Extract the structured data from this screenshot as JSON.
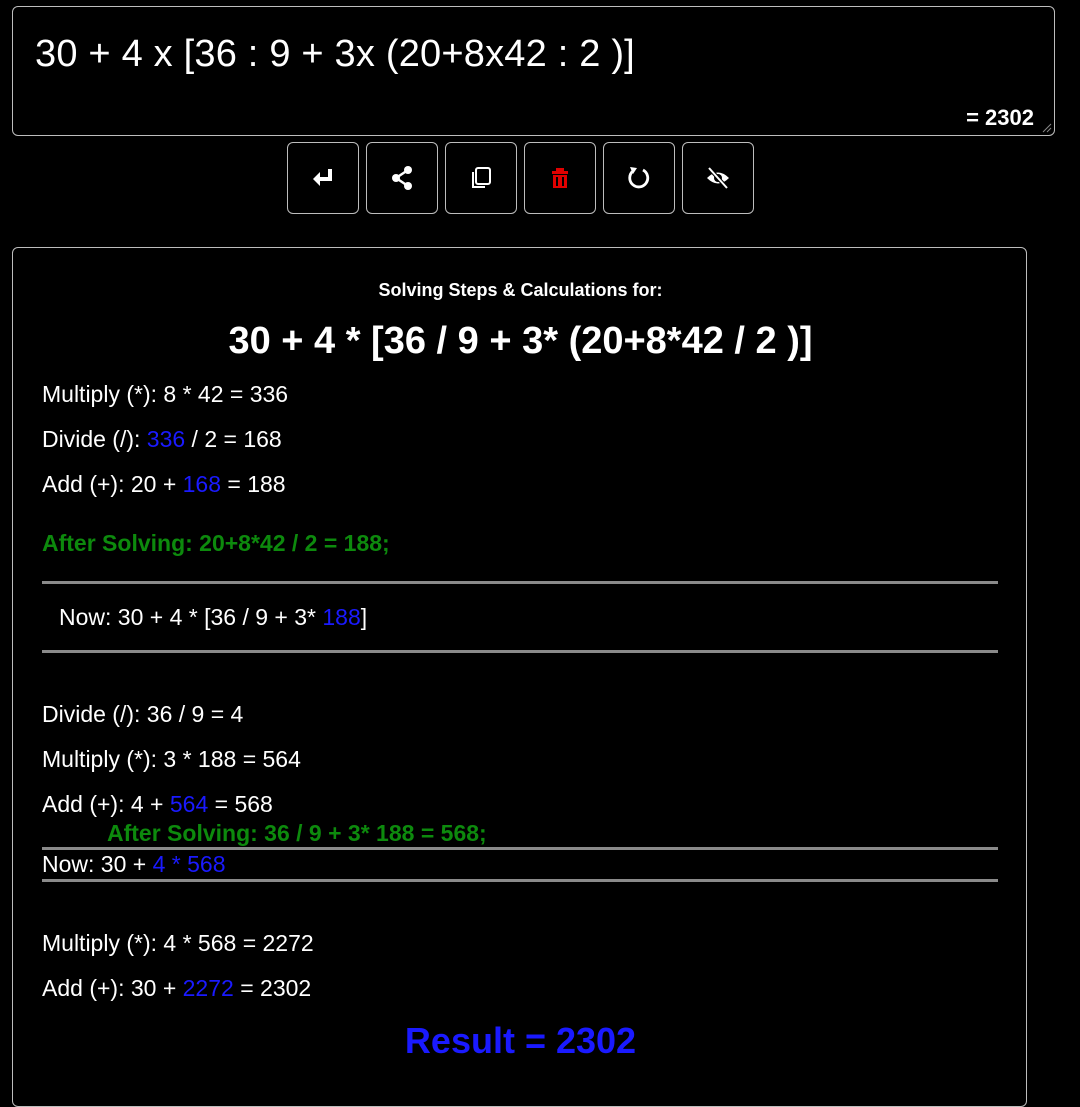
{
  "input": {
    "expression": "30 + 4 x [36 : 9 + 3x (20+8x42 : 2 )]",
    "result": "= 2302"
  },
  "toolbar": {
    "buttons": [
      {
        "name": "enter-button",
        "icon": "enter-icon"
      },
      {
        "name": "share-button",
        "icon": "share-icon"
      },
      {
        "name": "copy-button",
        "icon": "copy-icon"
      },
      {
        "name": "delete-button",
        "icon": "trash-icon",
        "color": "#e00000"
      },
      {
        "name": "reset-button",
        "icon": "refresh-icon"
      },
      {
        "name": "hide-button",
        "icon": "eye-off-icon"
      }
    ]
  },
  "steps": {
    "heading": "Solving Steps & Calculations for:",
    "expression": "30 + 4 * [36 / 9 + 3* (20+8*42 / 2 )]",
    "group1": {
      "s1": "Multiply (*): 8 * 42 = 336",
      "s2_label": "Divide (/): ",
      "s2_hl": "336",
      "s2_rest": " / 2 = 168",
      "s3_label": "Add (+): 20 + ",
      "s3_hl": "168",
      "s3_rest": " = 188",
      "after": "After Solving: 20+8*42 / 2 = 188;",
      "now_label": "Now: 30 + 4 * [36 / 9 + 3* ",
      "now_hl": "188",
      "now_rest": "]"
    },
    "group2": {
      "s1": "Divide (/): 36 / 9 = 4",
      "s2": "Multiply (*): 3 * 188 = 564",
      "s3_label": "Add (+): 4 + ",
      "s3_hl": "564",
      "s3_rest": " = 568",
      "after": "After Solving: 36 / 9 + 3* 188 = 568;",
      "now_label": "Now: 30 + ",
      "now_hl": "4 * 568"
    },
    "group3": {
      "s1": "Multiply (*): 4 * 568 = 2272",
      "s2_label": "Add (+): 30 + ",
      "s2_hl": "2272",
      "s2_rest": " = 2302"
    },
    "result": "Result = 2302"
  },
  "colors": {
    "background": "#000000",
    "highlight": "#1a1aff",
    "after_solving": "#0d8a0d",
    "delete": "#e00000"
  }
}
